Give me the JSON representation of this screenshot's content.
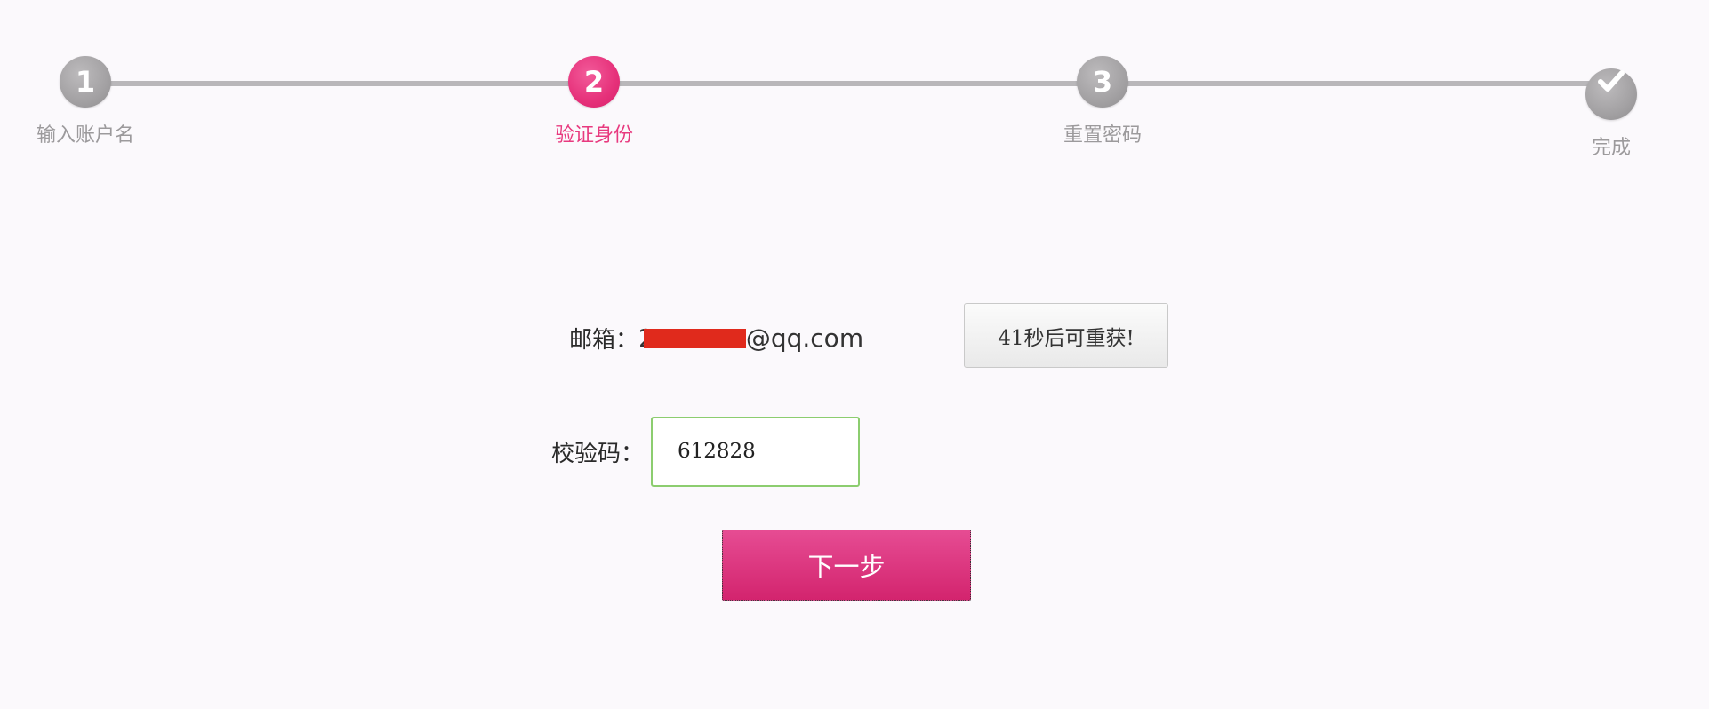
{
  "stepper": {
    "steps": [
      {
        "number": "1",
        "label": "输入账户名",
        "state": "done"
      },
      {
        "number": "2",
        "label": "验证身份",
        "state": "active"
      },
      {
        "number": "3",
        "label": "重置密码",
        "state": "pending"
      },
      {
        "number": "",
        "label": "完成",
        "state": "pending",
        "icon": "checkmark-icon"
      }
    ]
  },
  "colors": {
    "accent": "#e6317a",
    "inactive_step": "#a3a1a3",
    "input_border": "#8ccd6f",
    "redaction": "#e02a1c"
  },
  "form": {
    "email_label": "邮箱：",
    "email_prefix": "2",
    "email_suffix": "@qq.com",
    "resend_label": "41秒后可重获!",
    "code_label": "校验码：",
    "code_value": "612828",
    "next_label": "下一步"
  }
}
